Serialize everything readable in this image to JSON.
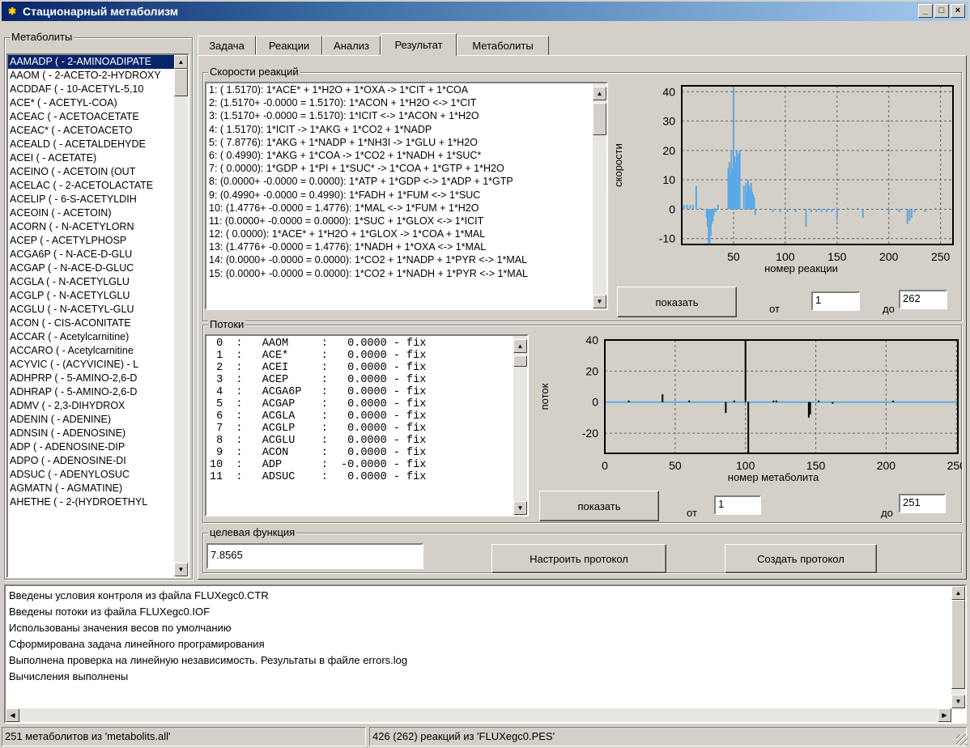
{
  "window": {
    "title": "Стационарный метаболизм",
    "min": "_",
    "max": "□",
    "close": "×"
  },
  "metabolites_panel": {
    "label": "Метаболиты",
    "items": [
      "AAMADP ( - 2-AMINOADIPATE",
      "AAOM (   - 2-ACETO-2-HYDROXY",
      "ACDDAF ( - 10-ACETYL-5,10",
      "ACE* (   - ACETYL-COA)",
      "ACEAC (  - ACETOACETATE",
      "ACEAC* ( - ACETOACETO",
      "ACEALD ( - ACETALDEHYDE",
      "ACEI (   - ACETATE)",
      "ACEINO ( - ACETOIN (OUT",
      "ACELAC ( - 2-ACETOLACTATE",
      "ACELIP ( - 6-S-ACETYLDIH",
      "ACEOIN ( - ACETOIN)",
      "ACORN (  - N-ACETYLORN",
      "ACEP (   - ACETYLPHOSP",
      "ACGA6P ( - N-ACE-D-GLU",
      "ACGAP (  - N-ACE-D-GLUC",
      "ACGLA (  - N-ACETYLGLU",
      "ACGLP (  - N-ACETYLGLU",
      "ACGLU (  - N-ACETYL-GLU",
      "ACON (   - CIS-ACONITATE",
      "ACCAR (  - Acetylcarnitine)",
      "ACCARO ( - Acetylcarnitine",
      "ACYVIC ( - (ACYVICINE) - L",
      "ADHPRP ( - 5-AMINO-2,6-D",
      "ADHRAP ( - 5-AMINO-2,6-D",
      "ADMV (   - 2,3-DIHYDROX",
      "ADENIN ( - ADENINE)",
      "ADNSIN ( - ADENOSINE)",
      "ADP (    - ADENOSINE-DIP",
      "ADPO (   - ADENOSINE-DI",
      "ADSUC (  - ADENYLOSUC",
      "AGMATN ( - AGMATINE)",
      "AHETHE ( - 2-(HYDROETHYL"
    ]
  },
  "tabs": [
    "Задача",
    "Реакции",
    "Анализ",
    "Результат",
    "Метаболиты"
  ],
  "active_tab": "Результат",
  "rates": {
    "label": "Скорости реакций",
    "lines": [
      "1: (  1.5170):   1*ACE* + 1*H2O + 1*OXA -> 1*CIT + 1*COA",
      "2: (1.5170+ -0.0000 = 1.5170):   1*ACON + 1*H2O <-> 1*CIT",
      "3: (1.5170+ -0.0000 = 1.5170):   1*ICIT <-> 1*ACON + 1*H2O",
      "4: (  1.5170):   1*ICIT -> 1*AKG + 1*CO2 + 1*NADP",
      "5: (  7.8776):   1*AKG + 1*NADP + 1*NH3I -> 1*GLU + 1*H2O",
      "6: (  0.4990):   1*AKG + 1*COA -> 1*CO2 + 1*NADH + 1*SUC*",
      "7: (  0.0000):   1*GDP + 1*PI + 1*SUC* -> 1*COA + 1*GTP + 1*H2O",
      "8: (0.0000+ -0.0000 = 0.0000):   1*ATP + 1*GDP <-> 1*ADP + 1*GTP",
      "9: (0.4990+ -0.0000 = 0.4990):   1*FADH + 1*FUM <-> 1*SUC",
      "10: (1.4776+ -0.0000 = 1.4776):   1*MAL <-> 1*FUM + 1*H2O",
      "11: (0.0000+ -0.0000 = 0.0000):   1*SUC + 1*GLOX <-> 1*ICIT",
      "12: (  0.0000):   1*ACE* + 1*H2O + 1*GLOX -> 1*COA + 1*MAL",
      "13: (1.4776+ -0.0000 = 1.4776):   1*NADH + 1*OXA <-> 1*MAL",
      "14: (0.0000+ -0.0000 = 0.0000):   1*CO2 + 1*NADP + 1*PYR <-> 1*MAL",
      "15: (0.0000+ -0.0000 = 0.0000):   1*CO2 + 1*NADH + 1*PYR <-> 1*MAL"
    ],
    "show_label": "показать",
    "from_label": "от",
    "from_value": "1",
    "to_label": "до",
    "to_value": "262"
  },
  "flows": {
    "label": "Потоки",
    "lines": [
      " 0  :   AAOM     :   0.0000 - fix",
      " 1  :   ACE*     :   0.0000 - fix",
      " 2  :   ACEI     :   0.0000 - fix",
      " 3  :   ACEP     :   0.0000 - fix",
      " 4  :   ACGA6P   :   0.0000 - fix",
      " 5  :   ACGAP    :   0.0000 - fix",
      " 6  :   ACGLA    :   0.0000 - fix",
      " 7  :   ACGLP    :   0.0000 - fix",
      " 8  :   ACGLU    :   0.0000 - fix",
      " 9  :   ACON     :   0.0000 - fix",
      "10  :   ADP      :  -0.0000 - fix",
      "11  :   ADSUC    :   0.0000 - fix"
    ],
    "show_label": "показать",
    "from_label": "от",
    "from_value": "1",
    "to_label": "до",
    "to_value": "251"
  },
  "objective": {
    "label": "целевая функция",
    "value": "7.8565",
    "configure_button": "Настроить протокол",
    "create_button": "Создать протокол"
  },
  "log": [
    "Введены условия контроля из файла FLUXegc0.CTR",
    "Введены потоки из файла FLUXegc0.IOF",
    "Использованы значения весов по умолчанию",
    "Сформирована задача линейного програмирования",
    "Выполнена проверка на линейную независимость. Результаты в файле errors.log",
    "Вычисления выполнены"
  ],
  "status": {
    "left": "251 метаболитов из 'metabolits.all'",
    "right": "426 (262) реакций из 'FLUXegc0.PES'"
  },
  "chart_data": [
    {
      "type": "bar",
      "xlabel": "номер реакции",
      "ylabel": "скорости",
      "xlim": [
        0,
        262
      ],
      "ylim": [
        -12,
        42
      ],
      "xticks": [
        50,
        100,
        150,
        200,
        250
      ],
      "yticks": [
        -10,
        0,
        10,
        20,
        30,
        40
      ],
      "grid": true,
      "color": "#5aa8e6",
      "x": [
        2,
        5,
        8,
        11,
        14,
        18,
        21,
        24,
        25,
        26,
        27,
        28,
        29,
        30,
        31,
        32,
        33,
        35,
        45,
        46,
        47,
        48,
        49,
        50,
        51,
        52,
        53,
        54,
        55,
        56,
        60,
        62,
        63,
        64,
        65,
        66,
        67,
        68,
        69,
        70,
        71,
        88,
        95,
        102,
        110,
        120,
        125,
        130,
        135,
        140,
        145,
        150,
        160,
        170,
        175,
        200,
        210,
        218,
        220,
        222,
        225,
        235,
        245
      ],
      "values": [
        1.5,
        1.5,
        1.5,
        1.5,
        7.9,
        0.5,
        0,
        -3,
        -6,
        -12,
        -12,
        -9,
        -5,
        -4,
        -2,
        0.5,
        -1,
        1.5,
        14,
        16,
        12,
        20,
        14,
        42,
        18,
        16,
        20,
        18,
        19,
        20,
        8,
        9,
        6,
        10,
        8,
        7,
        9,
        6,
        5,
        4,
        -2,
        -1,
        -1,
        -1,
        -1,
        -6,
        -1,
        -1,
        -1,
        -1,
        -1,
        -4,
        0.5,
        0.5,
        -3,
        -1,
        -1,
        -5,
        -4,
        -3,
        -1,
        -1,
        0.5
      ]
    },
    {
      "type": "bar",
      "xlabel": "номер метаболита",
      "ylabel": "поток",
      "xlim": [
        0,
        251
      ],
      "ylim": [
        -33,
        40
      ],
      "xticks": [
        0,
        50,
        100,
        150,
        200,
        250
      ],
      "yticks": [
        -20,
        0,
        20,
        40
      ],
      "grid": true,
      "color": "#000000",
      "baseline_color": "#5aa8e6",
      "x": [
        17,
        41,
        60,
        86,
        92,
        100,
        102,
        120,
        122,
        145,
        146,
        152,
        162,
        205
      ],
      "values": [
        1,
        5,
        1,
        -7,
        1,
        40,
        -33,
        1,
        1,
        -10,
        -8,
        1,
        -1,
        1
      ]
    }
  ]
}
